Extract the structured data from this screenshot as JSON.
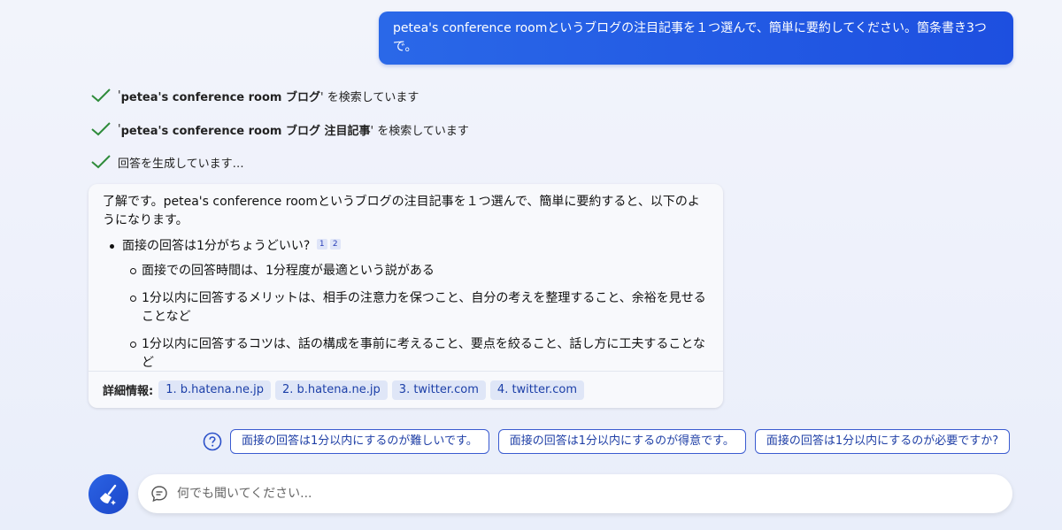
{
  "user_message": "petea's conference roomというブログの注目記事を１つ選んで、簡単に要約してください。箇条書き3つで。",
  "status_steps": [
    {
      "prefix": "'",
      "query": "petea's conference room ブログ",
      "suffix": "' を検索しています"
    },
    {
      "prefix": "'",
      "query": "petea's conference room ブログ 注目記事",
      "suffix": "' を検索しています"
    },
    {
      "prefix": "",
      "query": "",
      "suffix": "回答を生成しています…"
    }
  ],
  "answer": {
    "intro": "了解です。petea's conference roomというブログの注目記事を１つ選んで、簡単に要約すると、以下のようになります。",
    "main_point": "面接の回答は1分がちょうどいい?",
    "citations": [
      "1",
      "2"
    ],
    "sub_points": [
      "面接での回答時間は、1分程度が最適という説がある",
      "1分以内に回答するメリットは、相手の注意力を保つこと、自分の考えを整理すること、余裕を見せることなど",
      "1分以内に回答するコツは、話の構成を事前に考えること、要点を絞ること、話し方に工夫することなど"
    ],
    "sources_label": "詳細情報:",
    "sources": [
      "1. b.hatena.ne.jp",
      "2. b.hatena.ne.jp",
      "3. twitter.com",
      "4. twitter.com"
    ]
  },
  "suggestions": [
    "面接の回答は1分以内にするのが難しいです。",
    "面接の回答は1分以内にするのが得意です。",
    "面接の回答は1分以内にするのが必要ですか?"
  ],
  "input": {
    "placeholder": "何でも聞いてください..."
  },
  "colors": {
    "accent": "#1d4fe0",
    "check": "#2e8b3a"
  }
}
